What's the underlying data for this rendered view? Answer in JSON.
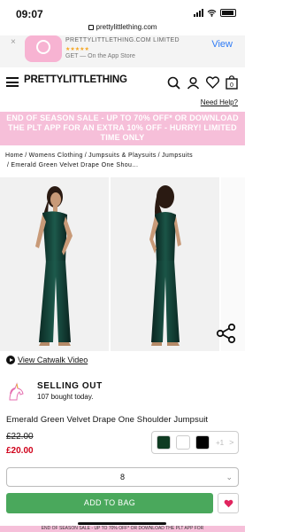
{
  "status": {
    "time": "09:07"
  },
  "browser": {
    "url": "prettylittlething.com"
  },
  "app_banner": {
    "close": "×",
    "name": "PRETTYLITTLETHING.COM LIMITED",
    "stars": "★★★★★",
    "store": "GET — On the App Store",
    "action": "View"
  },
  "header": {
    "logo": "PRETTYLITTLETHING",
    "help": "Need Help?",
    "bag_count": "0"
  },
  "promo": "END OF SEASON SALE - UP TO 70% OFF* OR DOWNLOAD THE PLT APP FOR AN EXTRA 10% OFF - HURRY! LIMITED TIME ONLY",
  "breadcrumbs": [
    "Home",
    "Womens Clothing",
    "Jumpsuits & Playsuits",
    "Jumpsuits",
    "Emerald Green Velvet Drape One Shou..."
  ],
  "catwalk": "View Catwalk Video",
  "selling": {
    "title": "SELLING OUT",
    "subtitle": "107 bought today."
  },
  "product": {
    "title": "Emerald Green Velvet Drape One Shoulder Jumpsuit",
    "price_old": "£22.00",
    "price_new": "£20.00"
  },
  "swatches": {
    "colors": [
      "#0f3b22",
      "#ffffff",
      "#000000"
    ],
    "more": "+1",
    "chevron": ">"
  },
  "size": {
    "selected": "8",
    "arrow": "⌄"
  },
  "add_to_bag": "ADD TO BAG",
  "footer_promo": "END OF SEASON SALE - UP TO 70% OFF* OR DOWNLOAD THE PLT APP FOR"
}
